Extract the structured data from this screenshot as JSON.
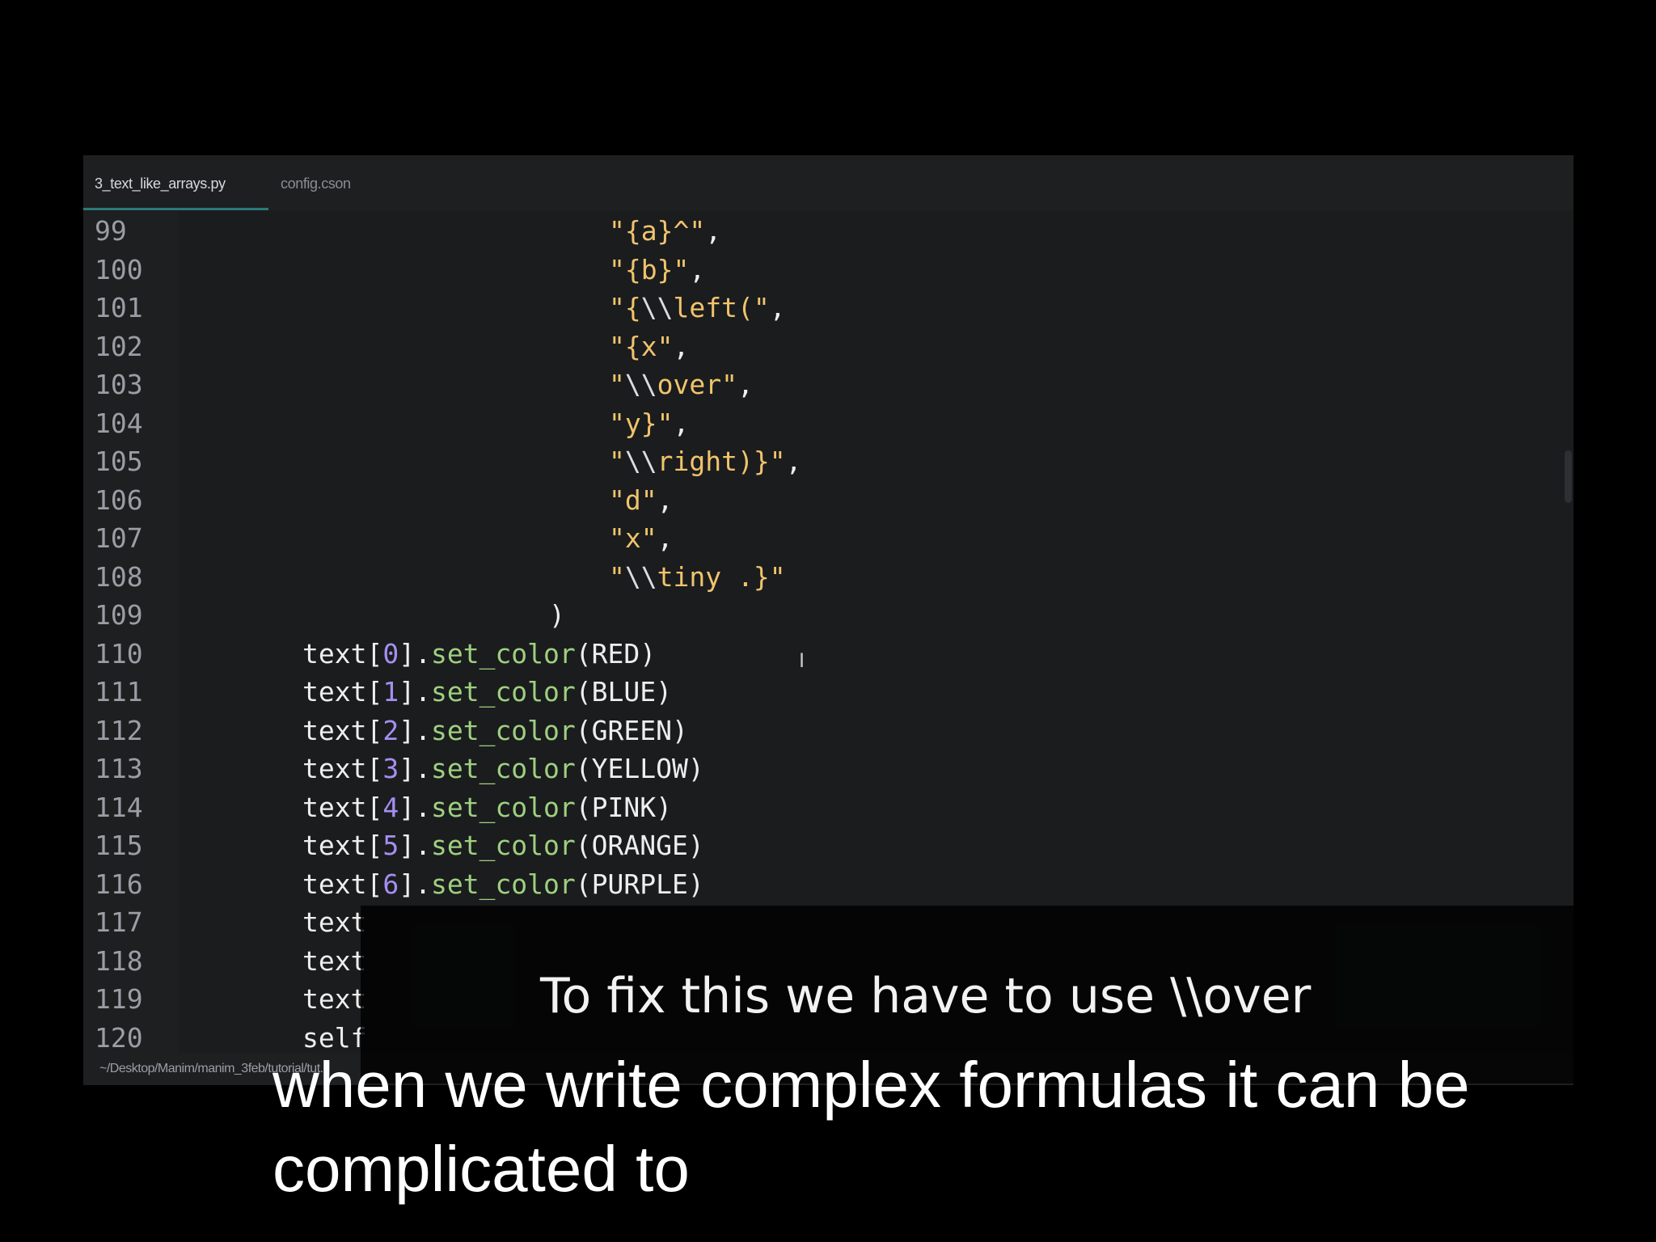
{
  "editor": {
    "tabs": [
      {
        "label": "3_text_like_arrays.py",
        "active": true
      },
      {
        "label": "config.cson",
        "active": false
      }
    ],
    "status_path": "~/Desktop/Manim/manim_3feb/tutorial/tut...",
    "lines": [
      {
        "n": "99",
        "tokens": [
          {
            "t": "\"{a}^\"",
            "c": "str"
          },
          {
            "t": ",",
            "c": "plain"
          }
        ]
      },
      {
        "n": "100",
        "tokens": [
          {
            "t": "\"{b}\"",
            "c": "str"
          },
          {
            "t": ",",
            "c": "plain"
          }
        ]
      },
      {
        "n": "101",
        "tokens": [
          {
            "t": "\"{",
            "c": "str"
          },
          {
            "t": "\\\\",
            "c": "esc"
          },
          {
            "t": "left(\"",
            "c": "str"
          },
          {
            "t": ",",
            "c": "plain"
          }
        ]
      },
      {
        "n": "102",
        "tokens": [
          {
            "t": "\"{x\"",
            "c": "str"
          },
          {
            "t": ",",
            "c": "plain"
          }
        ]
      },
      {
        "n": "103",
        "tokens": [
          {
            "t": "\"",
            "c": "str"
          },
          {
            "t": "\\\\",
            "c": "esc"
          },
          {
            "t": "over\"",
            "c": "str"
          },
          {
            "t": ",",
            "c": "plain"
          }
        ]
      },
      {
        "n": "104",
        "tokens": [
          {
            "t": "\"y}\"",
            "c": "str"
          },
          {
            "t": ",",
            "c": "plain"
          }
        ]
      },
      {
        "n": "105",
        "tokens": [
          {
            "t": "\"",
            "c": "str"
          },
          {
            "t": "\\\\",
            "c": "esc"
          },
          {
            "t": "right)}\"",
            "c": "str"
          },
          {
            "t": ",",
            "c": "plain"
          }
        ]
      },
      {
        "n": "106",
        "tokens": [
          {
            "t": "\"d\"",
            "c": "str"
          },
          {
            "t": ",",
            "c": "plain"
          }
        ]
      },
      {
        "n": "107",
        "tokens": [
          {
            "t": "\"x\"",
            "c": "str"
          },
          {
            "t": ",",
            "c": "plain"
          }
        ]
      },
      {
        "n": "108",
        "tokens": [
          {
            "t": "\"",
            "c": "str"
          },
          {
            "t": "\\\\",
            "c": "esc"
          },
          {
            "t": "tiny .}\"",
            "c": "str"
          }
        ]
      },
      {
        "n": "109",
        "tokens": [
          {
            "t": ")",
            "c": "plain"
          }
        ]
      },
      {
        "n": "110",
        "tokens": [
          {
            "t": "text[",
            "c": "plain"
          },
          {
            "t": "0",
            "c": "num"
          },
          {
            "t": "].",
            "c": "plain"
          },
          {
            "t": "set_color",
            "c": "fn"
          },
          {
            "t": "(RED)",
            "c": "plain"
          }
        ]
      },
      {
        "n": "111",
        "tokens": [
          {
            "t": "text[",
            "c": "plain"
          },
          {
            "t": "1",
            "c": "num"
          },
          {
            "t": "].",
            "c": "plain"
          },
          {
            "t": "set_color",
            "c": "fn"
          },
          {
            "t": "(BLUE)",
            "c": "plain"
          }
        ]
      },
      {
        "n": "112",
        "tokens": [
          {
            "t": "text[",
            "c": "plain"
          },
          {
            "t": "2",
            "c": "num"
          },
          {
            "t": "].",
            "c": "plain"
          },
          {
            "t": "set_color",
            "c": "fn"
          },
          {
            "t": "(GREEN)",
            "c": "plain"
          }
        ]
      },
      {
        "n": "113",
        "tokens": [
          {
            "t": "text[",
            "c": "plain"
          },
          {
            "t": "3",
            "c": "num"
          },
          {
            "t": "].",
            "c": "plain"
          },
          {
            "t": "set_color",
            "c": "fn"
          },
          {
            "t": "(YELLOW)",
            "c": "plain"
          }
        ]
      },
      {
        "n": "114",
        "tokens": [
          {
            "t": "text[",
            "c": "plain"
          },
          {
            "t": "4",
            "c": "num"
          },
          {
            "t": "].",
            "c": "plain"
          },
          {
            "t": "set_color",
            "c": "fn"
          },
          {
            "t": "(PINK)",
            "c": "plain"
          }
        ]
      },
      {
        "n": "115",
        "tokens": [
          {
            "t": "text[",
            "c": "plain"
          },
          {
            "t": "5",
            "c": "num"
          },
          {
            "t": "].",
            "c": "plain"
          },
          {
            "t": "set_color",
            "c": "fn"
          },
          {
            "t": "(ORANGE)",
            "c": "plain"
          }
        ]
      },
      {
        "n": "116",
        "tokens": [
          {
            "t": "text[",
            "c": "plain"
          },
          {
            "t": "6",
            "c": "num"
          },
          {
            "t": "].",
            "c": "plain"
          },
          {
            "t": "set_color",
            "c": "fn"
          },
          {
            "t": "(PURPLE)",
            "c": "plain"
          }
        ]
      },
      {
        "n": "117",
        "tokens": [
          {
            "t": "text",
            "c": "plain"
          }
        ]
      },
      {
        "n": "118",
        "tokens": [
          {
            "t": "text",
            "c": "plain"
          }
        ]
      },
      {
        "n": "119",
        "tokens": [
          {
            "t": "text",
            "c": "plain"
          }
        ]
      },
      {
        "n": "120",
        "tokens": [
          {
            "t": "self",
            "c": "plain"
          }
        ]
      }
    ]
  },
  "captions": {
    "translated": "To fix this we have to use \\\\over",
    "original_line1": "when we write complex formulas it can be",
    "original_line2": "complicated to"
  },
  "colors": {
    "background": "#000000",
    "editor_bg": "#1b1c1e",
    "gutter_bg": "#1e1f21",
    "string": "#f0c46c",
    "function": "#9ed07f",
    "number": "#a58ff0",
    "plain": "#eeeeee",
    "tab_underline": "#2b7a78"
  }
}
